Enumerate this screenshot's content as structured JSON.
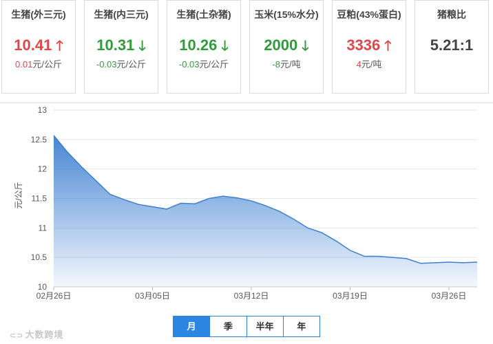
{
  "cards": [
    {
      "title": "生猪(外三元)",
      "value": "10.41",
      "arrow": "up",
      "change": "0.01",
      "unit": "元/公斤",
      "active": true
    },
    {
      "title": "生猪(内三元)",
      "value": "10.31",
      "arrow": "down",
      "change": "-0.03",
      "unit": "元/公斤"
    },
    {
      "title": "生猪(土杂猪)",
      "value": "10.26",
      "arrow": "down",
      "change": "-0.03",
      "unit": "元/公斤"
    },
    {
      "title": "玉米(15%水分)",
      "value": "2000",
      "arrow": "down",
      "change": "-8",
      "unit": "元/吨"
    },
    {
      "title": "豆粕(43%蛋白)",
      "value": "3336",
      "arrow": "up",
      "change": "4",
      "unit": "元/吨"
    },
    {
      "title": "猪粮比",
      "value": "5.21:1",
      "arrow": "none",
      "change": "",
      "unit": ""
    }
  ],
  "colors": {
    "up": "#e0474b",
    "down": "#2f9b3a",
    "line": "#3d7fd1",
    "accent": "#2a86e0"
  },
  "chart_data": {
    "type": "area",
    "ylabel": "元/公斤",
    "ylim": [
      10,
      13
    ],
    "yticks": [
      "13",
      "12.5",
      "12",
      "11.5",
      "11",
      "10.5",
      "10"
    ],
    "xticks": [
      "02月26日",
      "03月05日",
      "03月12日",
      "03月19日",
      "03月26日"
    ],
    "x": [
      "02月26日",
      "02月27日",
      "02月28日",
      "03月01日",
      "03月02日",
      "03月03日",
      "03月04日",
      "03月05日",
      "03月06日",
      "03月07日",
      "03月08日",
      "03月09日",
      "03月10日",
      "03月11日",
      "03月12日",
      "03月13日",
      "03月14日",
      "03月15日",
      "03月16日",
      "03月17日",
      "03月18日",
      "03月19日",
      "03月20日",
      "03月21日",
      "03月22日",
      "03月23日",
      "03月24日",
      "03月25日",
      "03月26日",
      "03月27日",
      "03月28日"
    ],
    "series": [
      {
        "values": [
          12.57,
          12.28,
          12.03,
          11.8,
          11.57,
          11.48,
          11.4,
          11.36,
          11.32,
          11.42,
          11.41,
          11.5,
          11.54,
          11.51,
          11.46,
          11.38,
          11.28,
          11.15,
          11.0,
          10.92,
          10.78,
          10.62,
          10.52,
          10.52,
          10.5,
          10.48,
          10.4,
          10.41,
          10.42,
          10.41,
          10.42
        ]
      }
    ],
    "grid": true
  },
  "tabs": [
    {
      "label": "月",
      "active": true
    },
    {
      "label": "季",
      "active": false
    },
    {
      "label": "半年",
      "active": false
    },
    {
      "label": "年",
      "active": false
    }
  ],
  "watermark": "大数跨境"
}
